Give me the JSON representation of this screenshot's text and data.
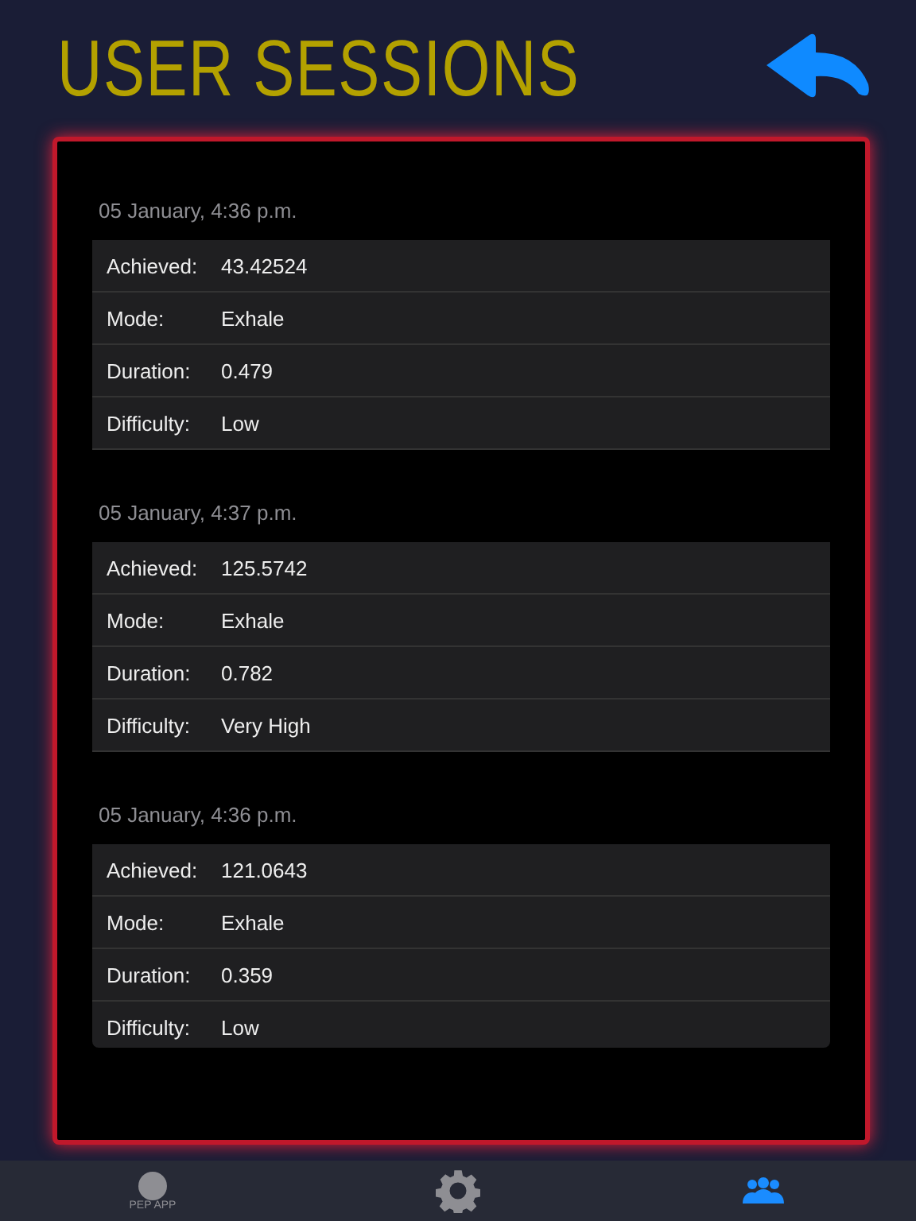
{
  "header": {
    "title": "USER SESSIONS"
  },
  "sessions": [
    {
      "date": "05 January, 4:36 p.m.",
      "fields": [
        {
          "label": "Achieved:",
          "value": "43.42524"
        },
        {
          "label": "Mode:",
          "value": "Exhale"
        },
        {
          "label": "Duration:",
          "value": "0.479"
        },
        {
          "label": "Difficulty:",
          "value": "Low"
        }
      ]
    },
    {
      "date": "05 January, 4:37 p.m.",
      "fields": [
        {
          "label": "Achieved:",
          "value": "125.5742"
        },
        {
          "label": "Mode:",
          "value": "Exhale"
        },
        {
          "label": "Duration:",
          "value": "0.782"
        },
        {
          "label": "Difficulty:",
          "value": "Very High"
        }
      ]
    },
    {
      "date": "05 January, 4:36 p.m.",
      "fields": [
        {
          "label": "Achieved:",
          "value": "121.0643"
        },
        {
          "label": "Mode:",
          "value": "Exhale"
        },
        {
          "label": "Duration:",
          "value": "0.359"
        },
        {
          "label": "Difficulty:",
          "value": "Low"
        }
      ]
    }
  ],
  "tab_bar": [
    {
      "kind": "circle",
      "label": "PEP APP",
      "selected": false
    },
    {
      "kind": "gear",
      "selected": false
    },
    {
      "kind": "people",
      "selected": true
    }
  ]
}
